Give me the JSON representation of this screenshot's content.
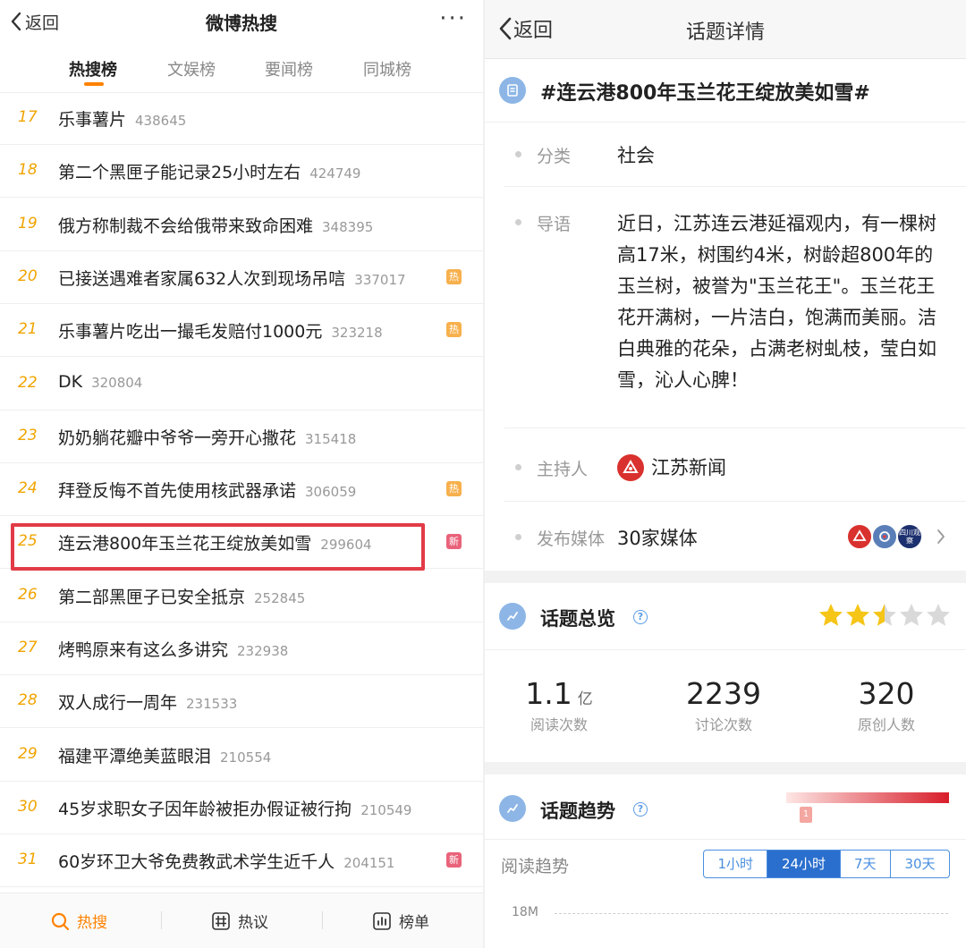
{
  "left": {
    "back": "返回",
    "title": "微博热搜",
    "more": "···",
    "tabs": [
      {
        "label": "热搜榜",
        "active": true
      },
      {
        "label": "文娱榜",
        "active": false
      },
      {
        "label": "要闻榜",
        "active": false
      },
      {
        "label": "同城榜",
        "active": false
      }
    ],
    "items": [
      {
        "rank": "17",
        "title": "乐事薯片",
        "count": "438645",
        "badge": ""
      },
      {
        "rank": "18",
        "title": "第二个黑匣子能记录25小时左右",
        "count": "424749",
        "badge": ""
      },
      {
        "rank": "19",
        "title": "俄方称制裁不会给俄带来致命困难",
        "count": "348395",
        "badge": ""
      },
      {
        "rank": "20",
        "title": "已接送遇难者家属632人次到现场吊唁",
        "count": "337017",
        "badge": "热"
      },
      {
        "rank": "21",
        "title": "乐事薯片吃出一撮毛发赔付1000元",
        "count": "323218",
        "badge": "热"
      },
      {
        "rank": "22",
        "title": "DK",
        "count": "320804",
        "badge": ""
      },
      {
        "rank": "23",
        "title": "奶奶躺花瓣中爷爷一旁开心撒花",
        "count": "315418",
        "badge": ""
      },
      {
        "rank": "24",
        "title": "拜登反悔不首先使用核武器承诺",
        "count": "306059",
        "badge": "热"
      },
      {
        "rank": "25",
        "title": "连云港800年玉兰花王绽放美如雪",
        "count": "299604",
        "badge": "新"
      },
      {
        "rank": "26",
        "title": "第二部黑匣子已安全抵京",
        "count": "252845",
        "badge": ""
      },
      {
        "rank": "27",
        "title": "烤鸭原来有这么多讲究",
        "count": "232938",
        "badge": ""
      },
      {
        "rank": "28",
        "title": "双人成行一周年",
        "count": "231533",
        "badge": ""
      },
      {
        "rank": "29",
        "title": "福建平潭绝美蓝眼泪",
        "count": "210554",
        "badge": ""
      },
      {
        "rank": "30",
        "title": "45岁求职女子因年龄被拒办假证被行拘",
        "count": "210549",
        "badge": ""
      },
      {
        "rank": "31",
        "title": "60岁环卫大爷免费教武术学生近千人",
        "count": "204151",
        "badge": "新"
      }
    ],
    "bottom_nav": [
      {
        "label": "热搜",
        "icon": "search-icon",
        "active": true
      },
      {
        "label": "热议",
        "icon": "hashtag-icon",
        "active": false
      },
      {
        "label": "榜单",
        "icon": "bar-chart-icon",
        "active": false
      }
    ]
  },
  "right": {
    "back": "返回",
    "title": "话题详情",
    "topic": "#连云港800年玉兰花王绽放美如雪#",
    "fields": {
      "category_label": "分类",
      "category_value": "社会",
      "intro_label": "导语",
      "intro_value": "近日，江苏连云港延福观内，有一棵树高17米，树围约4米，树龄超800年的玉兰树，被誉为\"玉兰花王\"。玉兰花王花开满树，一片洁白，饱满而美丽。洁白典雅的花朵，占满老树虬枝，莹白如雪，沁人心脾！",
      "host_label": "主持人",
      "host_value": "江苏新闻",
      "media_label": "发布媒体",
      "media_value": "30家媒体",
      "media_logo_text": "四川观察"
    },
    "overview": {
      "title": "话题总览",
      "rating": 2.5,
      "stats": [
        {
          "value": "1.1",
          "unit": "亿",
          "label": "阅读次数"
        },
        {
          "value": "2239",
          "unit": "",
          "label": "讨论次数"
        },
        {
          "value": "320",
          "unit": "",
          "label": "原创人数"
        }
      ]
    },
    "trend": {
      "title": "话题趋势",
      "marker": "1",
      "read_trend_label": "阅读趋势",
      "ranges": [
        {
          "label": "1小时",
          "active": false
        },
        {
          "label": "24小时",
          "active": true
        },
        {
          "label": "7天",
          "active": false
        },
        {
          "label": "30天",
          "active": false
        }
      ],
      "y_tick": "18M"
    }
  },
  "colors": {
    "accent_orange": "#ff8200",
    "rank_gold": "#f0a400",
    "hot_badge": "#f7b04c",
    "new_badge": "#e9627a",
    "highlight_red": "#e23b47",
    "link_blue": "#4a8fe0",
    "active_blue": "#2b6fce",
    "star_gold": "#f5c518"
  }
}
